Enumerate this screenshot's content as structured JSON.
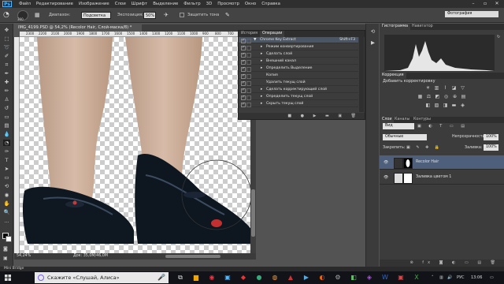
{
  "app": {
    "logo": "Ps"
  },
  "menu": [
    "Файл",
    "Редактирование",
    "Изображение",
    "Слои",
    "Шрифт",
    "Выделение",
    "Фильтр",
    "3D",
    "Просмотр",
    "Окно",
    "Справка"
  ],
  "options": {
    "size": "300",
    "mode_label": "Диапазон:",
    "mode_value": "Подсветка",
    "exposure_label": "Экспозиция:",
    "exposure_value": "50%",
    "protect_label": "Защитить тона",
    "workspace": "Фотография"
  },
  "document": {
    "tab_title": "IMG_4199.PSD @ 54,2% (Recolor Hair, Слой-маска/8) *",
    "ruler_marks": [
      "2300",
      "2200",
      "2100",
      "2000",
      "1900",
      "1800",
      "1700",
      "1600",
      "1500",
      "1400",
      "1300",
      "1200",
      "1100",
      "1000",
      "900",
      "800",
      "700",
      "600",
      "500"
    ],
    "zoom": "54,24%",
    "doc_size": "Док: 35,0M/46,0M"
  },
  "bridge": "Mini Bridge",
  "actions_panel": {
    "tabs": [
      "История",
      "Операции"
    ],
    "rows": [
      {
        "label": "Chrome Key Extract",
        "shortcut": "Shift+F3",
        "check": true,
        "head": true,
        "indent": 0
      },
      {
        "label": "Режим конвертирования",
        "check": true,
        "indent": 1
      },
      {
        "label": "Сделать слой",
        "check": true,
        "indent": 1
      },
      {
        "label": "Внешний канал",
        "check": true,
        "indent": 1
      },
      {
        "label": "Определить Выделение",
        "check": true,
        "indent": 1
      },
      {
        "label": "Копия",
        "check": true,
        "indent": 2
      },
      {
        "label": "Удалить текущ слой",
        "check": true,
        "indent": 2
      },
      {
        "label": "Сделать корректирующий слой",
        "check": true,
        "indent": 1
      },
      {
        "label": "Определить текущ слой",
        "check": true,
        "indent": 1
      },
      {
        "label": "Скрыть текущ слой",
        "check": true,
        "indent": 1
      }
    ],
    "footer": "■ ● ▶ ▬ ▣ 🗑"
  },
  "histogram": {
    "tabs": [
      "Гистограмма",
      "Навигатор"
    ]
  },
  "corrections": {
    "tabs": [
      "Коррекция"
    ],
    "title": "Добавить корректировку"
  },
  "layers_panel": {
    "tabs": [
      "Слои",
      "Каналы",
      "Контуры"
    ],
    "kind": "Вид",
    "blend": "Обычные",
    "opacity_label": "Непрозрачность:",
    "opacity": "100%",
    "lock_label": "Закрепить:",
    "fill_label": "Заливка:",
    "fill": "100%",
    "layers": [
      {
        "name": "Recolor Hair",
        "selected": true
      },
      {
        "name": "Заливка цветом 1",
        "selected": false
      }
    ]
  },
  "taskbar": {
    "search": "Скажите «Слушай, Алиса»",
    "lang": "РУС",
    "time": "13:06"
  }
}
